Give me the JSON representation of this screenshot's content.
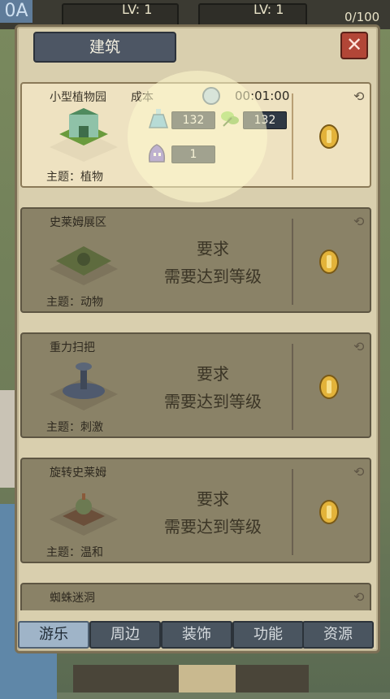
{
  "hud": {
    "left_value": "0A",
    "level_left": "LV: 1",
    "level_right": "LV: 1",
    "capacity": "0/100"
  },
  "panel": {
    "title": "建筑",
    "close_label": "✕"
  },
  "cards": [
    {
      "name": "小型植物园",
      "theme": "主题：植物",
      "cost_label": "成本",
      "timer": "00:01:00",
      "resources": [
        {
          "icon": "potion-icon",
          "value": "132"
        },
        {
          "icon": "leaf-icon",
          "value": "132"
        },
        {
          "icon": "slime-icon",
          "value": "1"
        }
      ]
    },
    {
      "name": "史莱姆展区",
      "theme": "主题：动物",
      "req_title": "要求",
      "req_text": "需要达到等级"
    },
    {
      "name": "重力扫把",
      "theme": "主题：刺激",
      "req_title": "要求",
      "req_text": "需要达到等级"
    },
    {
      "name": "旋转史莱姆",
      "theme": "主题：温和",
      "req_title": "要求",
      "req_text": "需要达到等级"
    },
    {
      "name": "蜘蛛迷洞"
    }
  ],
  "tabs": [
    {
      "label": "游乐",
      "active": true
    },
    {
      "label": "周边",
      "active": false
    },
    {
      "label": "装饰",
      "active": false
    },
    {
      "label": "功能",
      "active": false
    },
    {
      "label": "资源",
      "active": false
    }
  ],
  "colors": {
    "panel": "#d9cfae",
    "locked_card": "#8a8267",
    "active_tab": "#9fb4c8",
    "close": "#b24637"
  }
}
